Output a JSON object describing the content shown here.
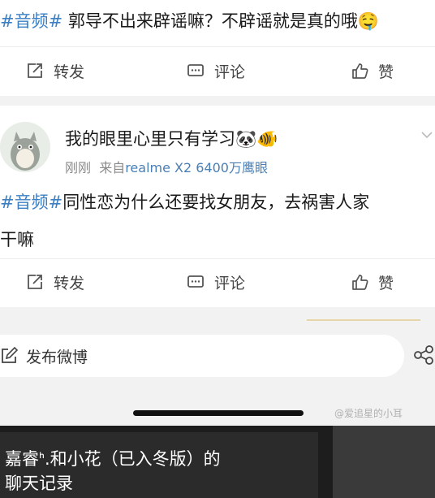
{
  "post1": {
    "topic": "#音频#",
    "text": " 郭导不出来辟谣嘛？不辟谣就是真的哦",
    "emoji": "🤤"
  },
  "actions": {
    "repost": "转发",
    "comment": "评论",
    "like": "赞"
  },
  "post2": {
    "username": "我的眼里心里只有学习",
    "username_emoji": "🐼🐠",
    "time": "刚刚",
    "source_prefix": "来自",
    "source": "realme X2 6400万鹰眼",
    "topic": "#音频#",
    "text_line1": "同性恋为什么还要找女朋友，去祸害人家",
    "text_line2": "干嘛"
  },
  "compose": {
    "placeholder": "发布微博"
  },
  "watermark": "@爱追星的小耳",
  "video": {
    "caption_line1": "嘉睿ᑋ.和小花（已入冬版）的",
    "caption_line2": "聊天记录"
  },
  "colors": {
    "topic": "#3b7fc4",
    "background": "#f2f2f2",
    "card": "#ffffff"
  }
}
